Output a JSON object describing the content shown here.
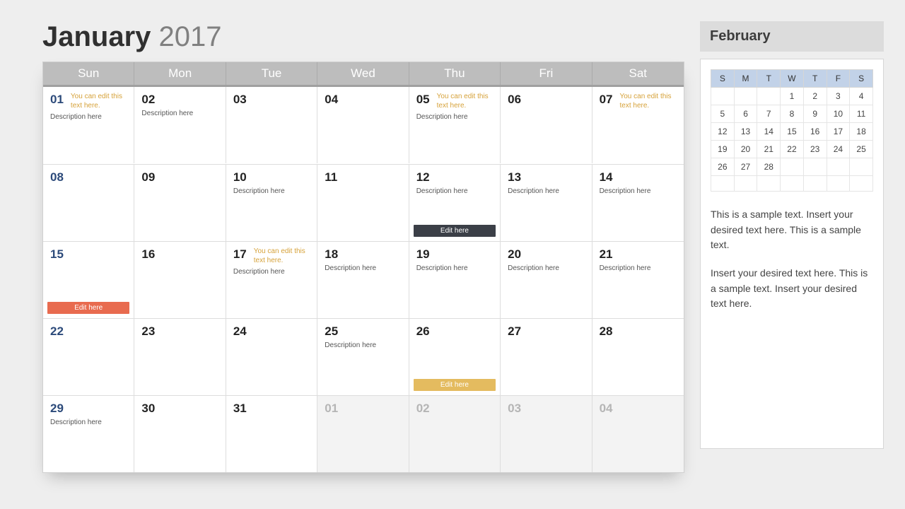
{
  "title": {
    "month": "January",
    "year": "2017"
  },
  "dow": [
    "Sun",
    "Mon",
    "Tue",
    "Wed",
    "Thu",
    "Fri",
    "Sat"
  ],
  "hint": "You can edit this text here.",
  "desc": "Description here",
  "tagLabel": "Edit here",
  "weeks": [
    [
      {
        "n": "01",
        "sun": true,
        "hint": true,
        "desc": true
      },
      {
        "n": "02",
        "desc": true
      },
      {
        "n": "03"
      },
      {
        "n": "04"
      },
      {
        "n": "05",
        "hint": true,
        "desc": true
      },
      {
        "n": "06"
      },
      {
        "n": "07",
        "hint": true
      }
    ],
    [
      {
        "n": "08",
        "sun": true
      },
      {
        "n": "09"
      },
      {
        "n": "10",
        "desc": true
      },
      {
        "n": "11"
      },
      {
        "n": "12",
        "desc": true,
        "tag": "dark"
      },
      {
        "n": "13",
        "desc": true
      },
      {
        "n": "14",
        "desc": true
      }
    ],
    [
      {
        "n": "15",
        "sun": true,
        "tag": "red"
      },
      {
        "n": "16"
      },
      {
        "n": "17",
        "hint": true,
        "desc": true
      },
      {
        "n": "18",
        "desc": true
      },
      {
        "n": "19",
        "desc": true
      },
      {
        "n": "20",
        "desc": true
      },
      {
        "n": "21",
        "desc": true
      }
    ],
    [
      {
        "n": "22",
        "sun": true
      },
      {
        "n": "23"
      },
      {
        "n": "24"
      },
      {
        "n": "25",
        "desc": true
      },
      {
        "n": "26",
        "tag": "yellow"
      },
      {
        "n": "27"
      },
      {
        "n": "28"
      }
    ],
    [
      {
        "n": "29",
        "sun": true,
        "desc": true
      },
      {
        "n": "30"
      },
      {
        "n": "31"
      },
      {
        "n": "01",
        "other": true
      },
      {
        "n": "02",
        "other": true
      },
      {
        "n": "03",
        "other": true
      },
      {
        "n": "04",
        "other": true
      }
    ]
  ],
  "side": {
    "title": "February",
    "miniHead": [
      "S",
      "M",
      "T",
      "W",
      "T",
      "F",
      "S"
    ],
    "miniRows": [
      [
        "",
        "",
        "",
        "1",
        "2",
        "3",
        "4"
      ],
      [
        "5",
        "6",
        "7",
        "8",
        "9",
        "10",
        "11"
      ],
      [
        "12",
        "13",
        "14",
        "15",
        "16",
        "17",
        "18"
      ],
      [
        "19",
        "20",
        "21",
        "22",
        "23",
        "24",
        "25"
      ],
      [
        "26",
        "27",
        "28",
        "",
        "",
        "",
        ""
      ],
      [
        "",
        "",
        "",
        "",
        "",
        "",
        ""
      ]
    ],
    "p1": "This is a sample text. Insert your desired text here. This is a sample text.",
    "p2": "Insert your desired text here. This is a sample text. Insert your desired text here."
  }
}
